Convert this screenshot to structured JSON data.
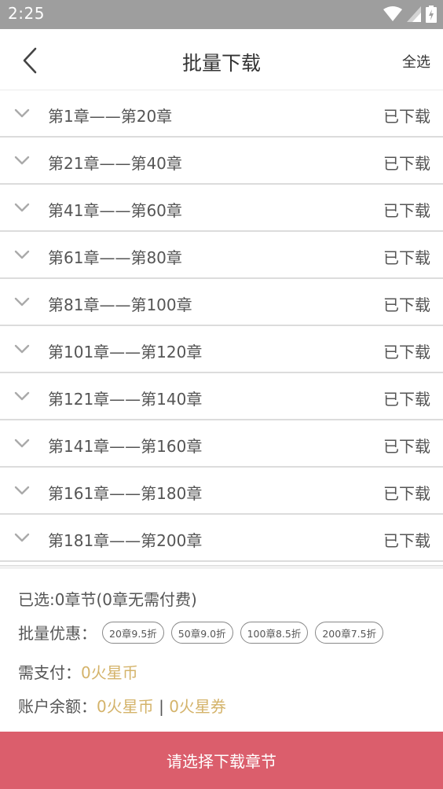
{
  "status_bar": {
    "time": "2:25"
  },
  "header": {
    "title": "批量下载",
    "select_all": "全选"
  },
  "chapters": [
    {
      "label": "第1章——第20章",
      "state": "已下载"
    },
    {
      "label": "第21章——第40章",
      "state": "已下载"
    },
    {
      "label": "第41章——第60章",
      "state": "已下载"
    },
    {
      "label": "第61章——第80章",
      "state": "已下载"
    },
    {
      "label": "第81章——第100章",
      "state": "已下载"
    },
    {
      "label": "第101章——第120章",
      "state": "已下载"
    },
    {
      "label": "第121章——第140章",
      "state": "已下载"
    },
    {
      "label": "第141章——第160章",
      "state": "已下载"
    },
    {
      "label": "第161章——第180章",
      "state": "已下载"
    },
    {
      "label": "第181章——第200章",
      "state": "已下载"
    }
  ],
  "summary": {
    "selected_text": "已选:0章节(0章无需付费)",
    "discount_label": "批量优惠：",
    "discounts": [
      "20章9.5折",
      "50章9.0折",
      "100章8.5折",
      "200章7.5折"
    ],
    "pay_label": "需支付：",
    "pay_value": "0火星币",
    "balance_label": "账户余额：",
    "balance_coins": "0火星币",
    "balance_separator": " | ",
    "balance_vouchers": "0火星券"
  },
  "download_button": "请选择下载章节",
  "colors": {
    "accent_button": "#db5e6c",
    "gold_text": "#d4b36a",
    "status_bar": "#9e9e9e"
  }
}
